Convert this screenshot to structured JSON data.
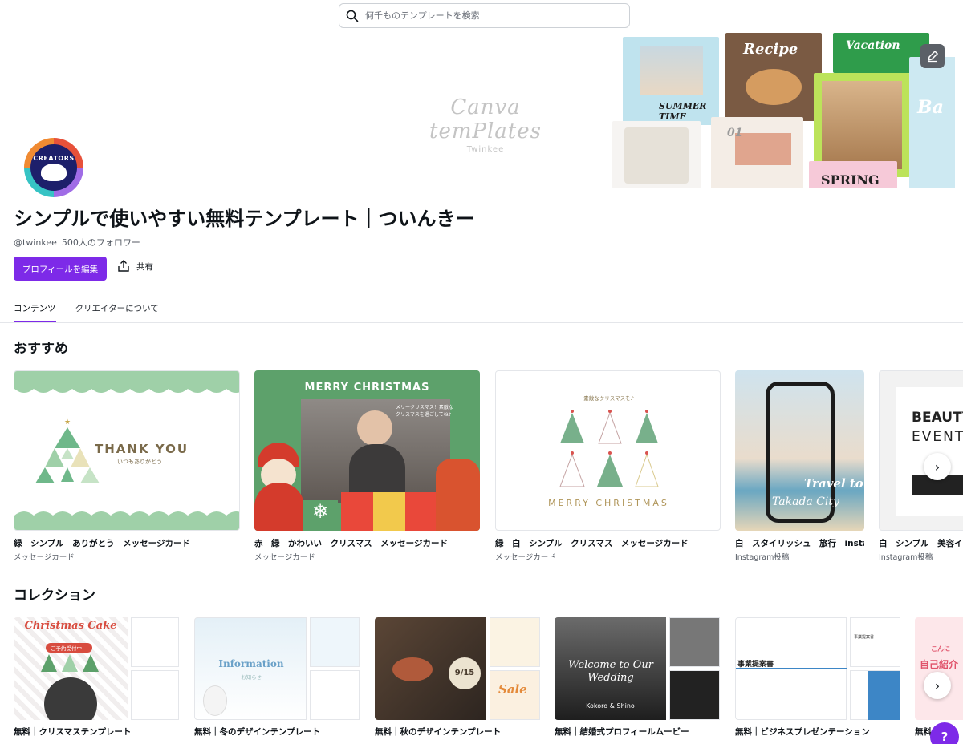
{
  "search": {
    "placeholder": "何千ものテンプレートを検索",
    "icon": "search-icon"
  },
  "banner": {
    "logo_title": "Canva temPlates",
    "logo_sub": "Twinkee",
    "collage_labels": [
      "Recipe",
      "Vacation",
      "SUMMER TIME",
      "SPRING",
      "01",
      "Ba"
    ],
    "edit_icon": "pencil-edit-icon"
  },
  "avatar": {
    "badge_text": "CREATORS"
  },
  "profile": {
    "title": "シンプルで使いやすい無料テンプレート｜ついんきー",
    "handle": "@twinkee",
    "followers": "500人のフォロワー",
    "edit_button": "プロフィールを編集",
    "share_button": "共有"
  },
  "tabs": [
    {
      "label": "コンテンツ",
      "active": true
    },
    {
      "label": "クリエイターについて",
      "active": false
    }
  ],
  "recommended": {
    "heading": "おすすめ",
    "items": [
      {
        "title": "緑　シンプル　ありがとう　メッセージカード",
        "type": "メッセージカード",
        "text1": "THANK YOU",
        "text2": "いつもありがとう"
      },
      {
        "title": "赤　緑　かわいい　クリスマス　メッセージカード",
        "type": "メッセージカード",
        "text1": "MERRY CHRISTMAS",
        "text2": "メリークリスマス！素敵なクリスマスを過ごしてね♪"
      },
      {
        "title": "緑　白　シンプル　クリスマス　メッセージカード",
        "type": "メッセージカード",
        "text1": "MERRY CHRISTMAS",
        "text2": "素敵なクリスマスを♪"
      },
      {
        "title": "白　スタイリッシュ　旅行　instagram投稿",
        "type": "Instagram投稿",
        "text1": "Travel to",
        "text2": "Takada City"
      },
      {
        "title": "白　シンプル　美容イベント",
        "type": "Instagram投稿",
        "text1": "BEAUTY",
        "text2": "EVENT"
      }
    ]
  },
  "collections": {
    "heading": "コレクション",
    "items": [
      {
        "title": "無料｜クリスマステンプレート",
        "text1": "Christmas Cake",
        "text2": "ご予約受付中！"
      },
      {
        "title": "無料｜冬のデザインテンプレート",
        "text1": "Information",
        "text2": "お知らせ"
      },
      {
        "title": "無料｜秋のデザインテンプレート",
        "text1": "9/15",
        "text2": "Sale"
      },
      {
        "title": "無料｜結婚式プロフィールムービー",
        "text1": "Welcome to Our Wedding",
        "text2": "Kokoro & Shino"
      },
      {
        "title": "無料｜ビジネスプレゼンテーション",
        "text1": "事業提案書",
        "text2": "事業提案書"
      },
      {
        "title": "無料",
        "text1": "こんに",
        "text2": "自己紹介"
      }
    ]
  },
  "help": {
    "label": "?"
  },
  "colors": {
    "accent": "#7d2ae8",
    "green": "#9fd0a8",
    "xmas_green": "#5da16b"
  }
}
